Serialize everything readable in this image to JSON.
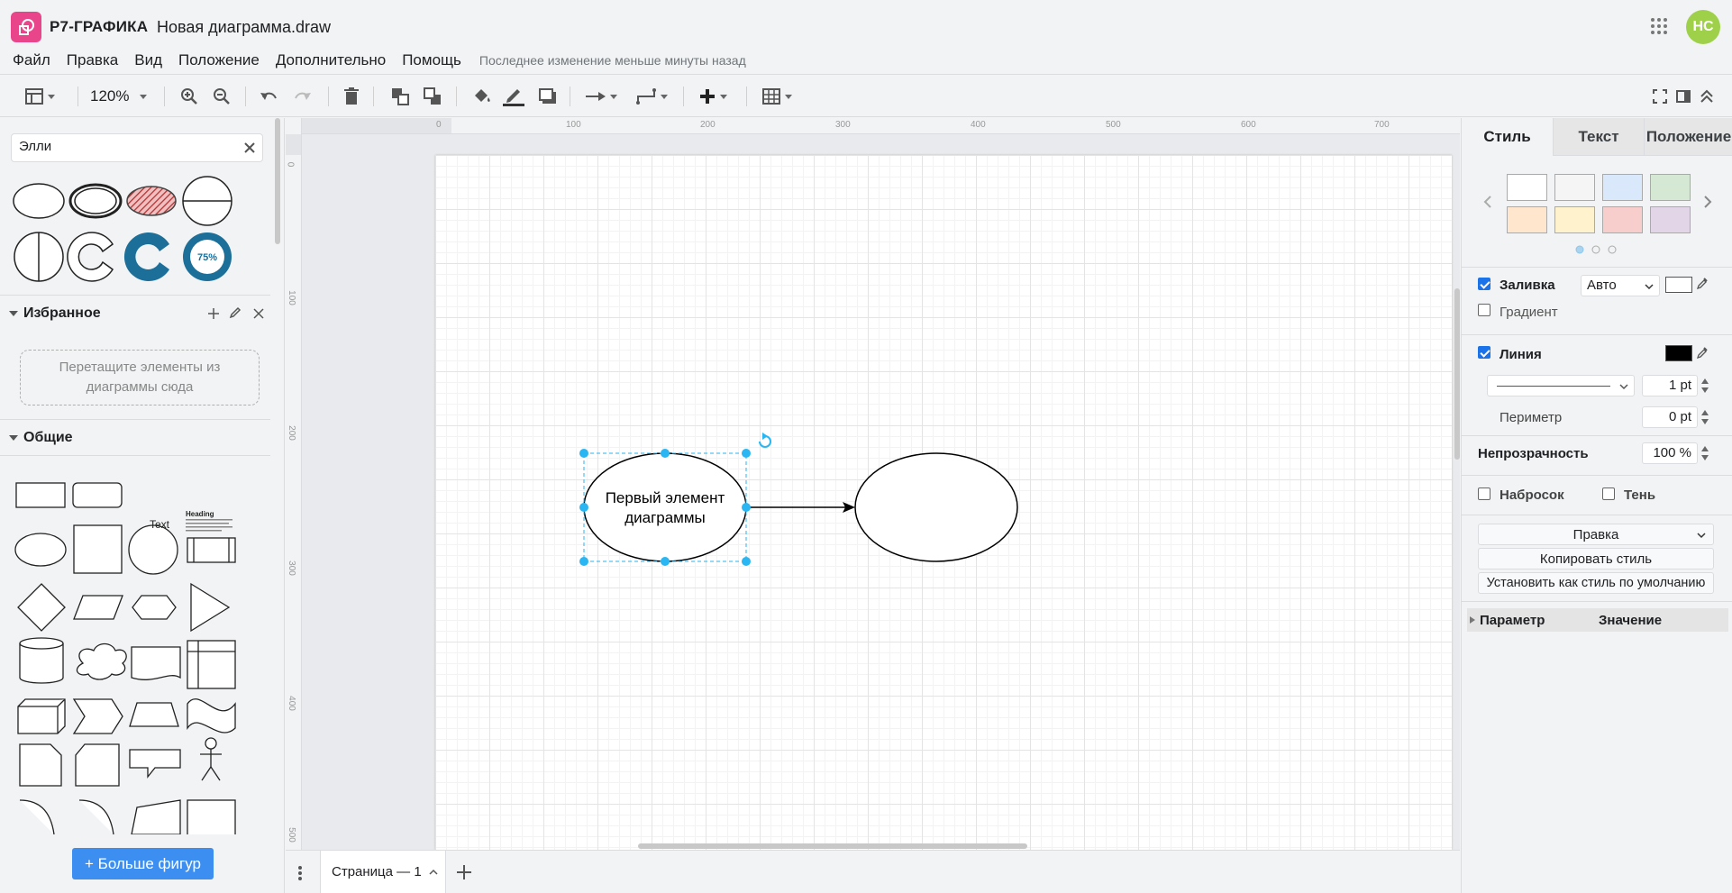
{
  "app": {
    "name": "Р7-ГРАФИКА",
    "doc_title": "Новая диаграмма.draw",
    "user_initials": "НС"
  },
  "menu": {
    "items": [
      "Файл",
      "Правка",
      "Вид",
      "Положение",
      "Дополнительно",
      "Помощь"
    ],
    "last_change": "Последнее изменение меньше минуты назад"
  },
  "toolbar": {
    "zoom": "120%"
  },
  "left_panel": {
    "search_value": "Элли",
    "favorites_title": "Избранное",
    "favorites_drop_text": "Перетащите элементы из диаграммы сюда",
    "general_title": "Общие",
    "more_shapes_label": "+ Больше фигур",
    "shape_text_sample": "Text",
    "shape_heading_sample": "Heading",
    "donut_label": "75%"
  },
  "ruler": {
    "top_labels": [
      "0",
      "100",
      "200",
      "300",
      "400",
      "500",
      "600",
      "700"
    ],
    "left_labels": [
      "0",
      "100",
      "200",
      "300",
      "400",
      "500"
    ]
  },
  "diagram": {
    "ellipse1_text_line1": "Первый элемент",
    "ellipse1_text_line2": "диаграммы",
    "accent_color": "#29b6f2"
  },
  "pages": {
    "tab_label": "Страница — 1"
  },
  "right_panel": {
    "tabs": [
      "Стиль",
      "Текст",
      "Положение"
    ],
    "swatch_colors": [
      "#ffffff",
      "#f5f5f5",
      "#dae8fc",
      "#d5e8d4",
      "#ffe6cc",
      "#fff2cc",
      "#f8cecc",
      "#e1d5e7"
    ],
    "fill_label": "Заливка",
    "fill_mode": "Авто",
    "gradient_label": "Градиент",
    "line_label": "Линия",
    "line_width": "1 pt",
    "perimeter_label": "Периметр",
    "perimeter_value": "0 pt",
    "opacity_label": "Непрозрачность",
    "opacity_value": "100 %",
    "sketch_label": "Набросок",
    "shadow_label": "Тень",
    "edit_select": "Правка",
    "copy_style_btn": "Копировать стиль",
    "set_default_btn": "Установить как стиль по умолчанию",
    "prop_col_param": "Параметр",
    "prop_col_value": "Значение"
  }
}
